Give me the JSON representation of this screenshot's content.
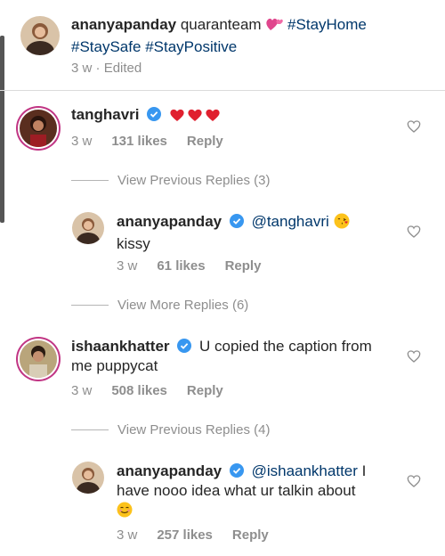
{
  "post": {
    "username": "ananyapanday",
    "caption_text": "quaranteam",
    "caption_tags": [
      "#StayHome",
      "#StaySafe",
      "#StayPositive"
    ],
    "time": "3 w",
    "edited": "Edited"
  },
  "comments": [
    {
      "username": "tanghavri",
      "time": "3 w",
      "likes": "131 likes",
      "reply_label": "Reply",
      "view_more": "View Previous Replies (3)",
      "reply": {
        "username": "ananyapanday",
        "mention": "@tanghavri",
        "text": "kissy",
        "time": "3 w",
        "likes": "61 likes",
        "reply_label": "Reply"
      },
      "view_more_after": "View More Replies (6)"
    },
    {
      "username": "ishaankhatter",
      "text_line1": "U copied the caption from",
      "text_line2": "me puppycat",
      "time": "3 w",
      "likes": "508 likes",
      "reply_label": "Reply",
      "view_more": "View Previous Replies (4)",
      "reply": {
        "username": "ananyapanday",
        "mention": "@ishaankhatter",
        "text_line1": "I",
        "text_line2": "have nooo idea what ur talkin about",
        "time": "3 w",
        "likes": "257 likes",
        "reply_label": "Reply"
      }
    }
  ],
  "colors": {
    "verified": "#3897f0",
    "tag": "#00376b",
    "meta": "#8e8e8e",
    "heart": "#ed4956"
  },
  "icons": [
    "verified-badge-icon",
    "heart-outline-icon",
    "heart-emoji-icon",
    "kiss-emoji-icon",
    "smiling-emoji-icon",
    "revolving-hearts-emoji-icon"
  ]
}
